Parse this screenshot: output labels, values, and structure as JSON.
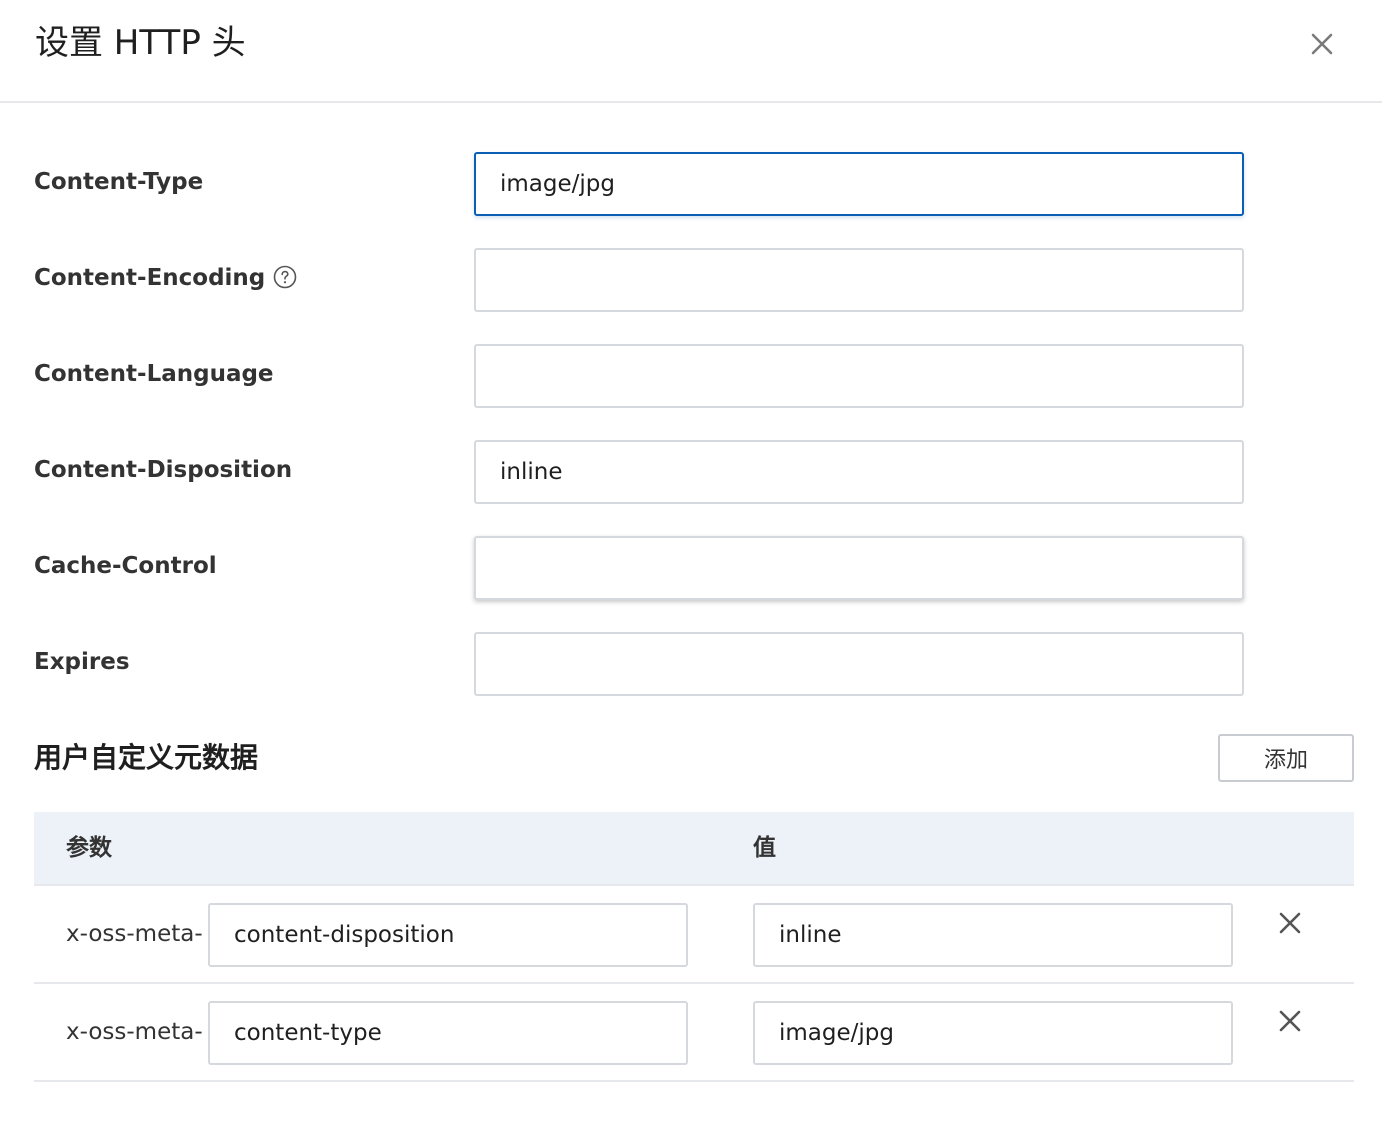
{
  "dialog": {
    "title": "设置 HTTP 头",
    "close_icon": "close-icon"
  },
  "fields": [
    {
      "label": "Content-Type",
      "value": "image/jpg",
      "placeholder": ""
    },
    {
      "label": "Content-Encoding",
      "value": "",
      "placeholder": "",
      "help_icon": "question-circle-icon"
    },
    {
      "label": "Content-Language",
      "value": "",
      "placeholder": ""
    },
    {
      "label": "Content-Disposition",
      "value": "inline",
      "placeholder": ""
    },
    {
      "label": "Cache-Control",
      "value": "",
      "placeholder": ""
    },
    {
      "label": "Expires",
      "value": "",
      "placeholder": ""
    }
  ],
  "metadata": {
    "section_title": "用户自定义元数据",
    "add_label": "添加",
    "columns": [
      "参数",
      "值"
    ],
    "rows": [
      {
        "prefix": "x-oss-meta-",
        "key": "content-disposition",
        "value": "inline"
      },
      {
        "prefix": "x-oss-meta-",
        "key": "content-type",
        "value": "image/jpg"
      }
    ]
  },
  "colors": {
    "focus_border": "#0a5fb4",
    "table_header_bg": "#edf2f8",
    "border": "#d5d8dc"
  }
}
